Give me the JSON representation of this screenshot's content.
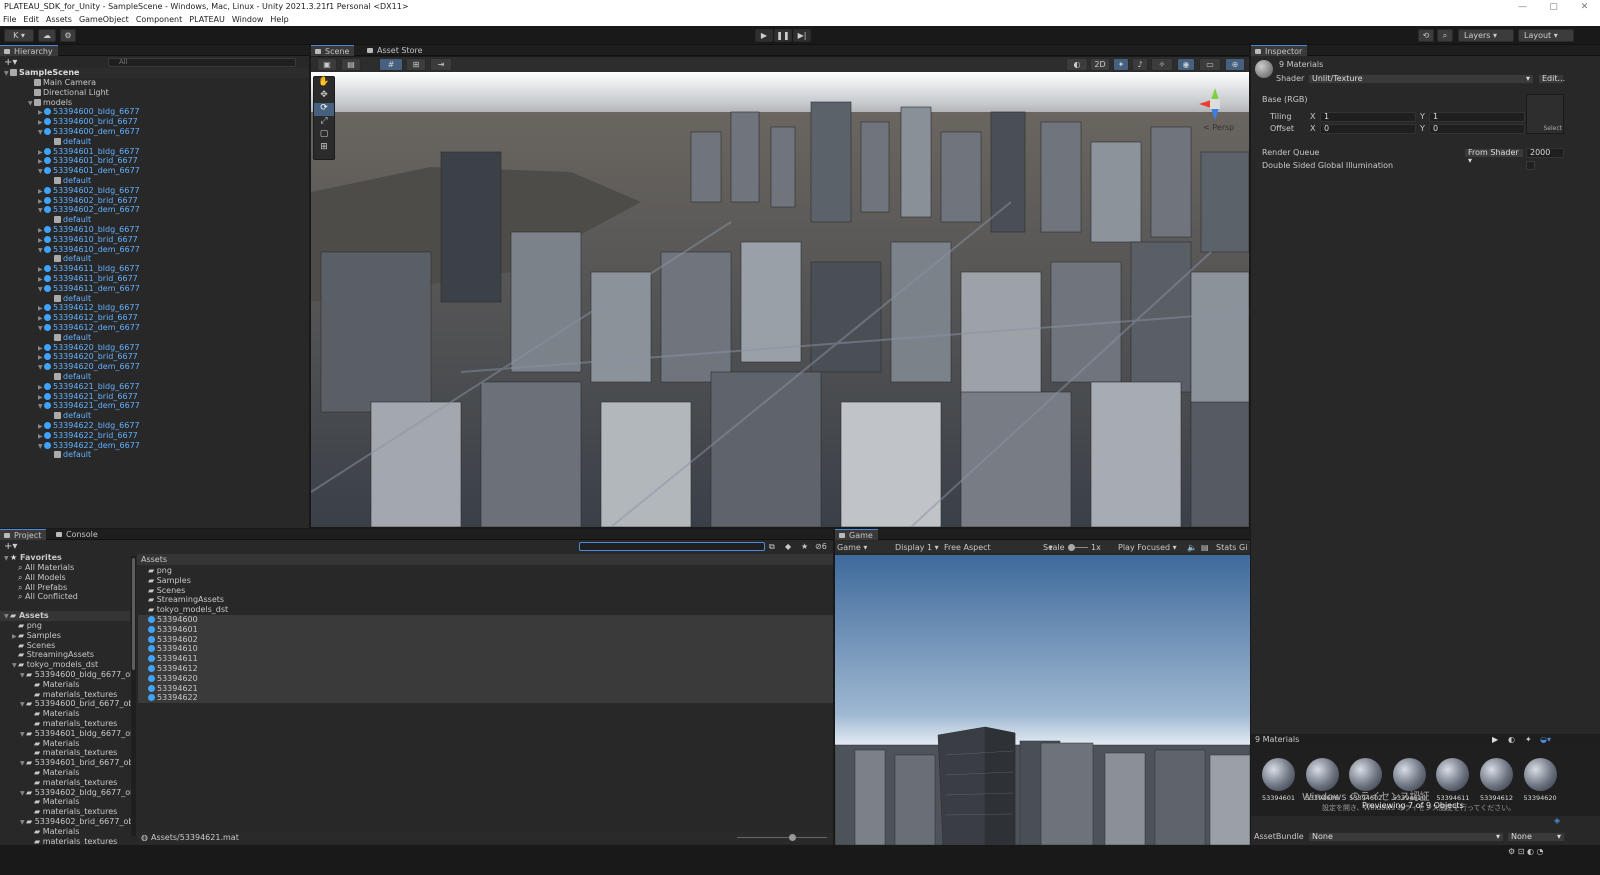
{
  "window": {
    "title": "PLATEAU_SDK_for_Unity - SampleScene - Windows, Mac, Linux - Unity 2021.3.21f1 Personal <DX11>",
    "min": "—",
    "max": "▢",
    "close": "✕"
  },
  "menu": [
    "File",
    "Edit",
    "Assets",
    "GameObject",
    "Component",
    "PLATEAU",
    "Window",
    "Help"
  ],
  "toolbar": {
    "account": "K ▾",
    "layers": "Layers",
    "layout": "Layout"
  },
  "hierarchy": {
    "tab": "Hierarchy",
    "search_placeholder": "All",
    "scene": "SampleScene",
    "items": [
      {
        "label": "Main Camera",
        "depth": 1,
        "type": "go"
      },
      {
        "label": "Directional Light",
        "depth": 1,
        "type": "go"
      },
      {
        "label": "models",
        "depth": 1,
        "type": "go",
        "arrow": "▼"
      },
      {
        "label": "53394600_bldg_6677",
        "depth": 2,
        "type": "prefab",
        "arrow": "▶"
      },
      {
        "label": "53394600_brid_6677",
        "depth": 2,
        "type": "prefab",
        "arrow": "▶"
      },
      {
        "label": "53394600_dem_6677",
        "depth": 2,
        "type": "prefab",
        "arrow": "▼"
      },
      {
        "label": "default",
        "depth": 3,
        "type": "go"
      },
      {
        "label": "53394601_bldg_6677",
        "depth": 2,
        "type": "prefab",
        "arrow": "▶"
      },
      {
        "label": "53394601_brid_6677",
        "depth": 2,
        "type": "prefab",
        "arrow": "▶"
      },
      {
        "label": "53394601_dem_6677",
        "depth": 2,
        "type": "prefab",
        "arrow": "▼"
      },
      {
        "label": "default",
        "depth": 3,
        "type": "go"
      },
      {
        "label": "53394602_bldg_6677",
        "depth": 2,
        "type": "prefab",
        "arrow": "▶"
      },
      {
        "label": "53394602_brid_6677",
        "depth": 2,
        "type": "prefab",
        "arrow": "▶"
      },
      {
        "label": "53394602_dem_6677",
        "depth": 2,
        "type": "prefab",
        "arrow": "▼"
      },
      {
        "label": "default",
        "depth": 3,
        "type": "go"
      },
      {
        "label": "53394610_bldg_6677",
        "depth": 2,
        "type": "prefab",
        "arrow": "▶"
      },
      {
        "label": "53394610_brid_6677",
        "depth": 2,
        "type": "prefab",
        "arrow": "▶"
      },
      {
        "label": "53394610_dem_6677",
        "depth": 2,
        "type": "prefab",
        "arrow": "▼"
      },
      {
        "label": "default",
        "depth": 3,
        "type": "go"
      },
      {
        "label": "53394611_bldg_6677",
        "depth": 2,
        "type": "prefab",
        "arrow": "▶"
      },
      {
        "label": "53394611_brid_6677",
        "depth": 2,
        "type": "prefab",
        "arrow": "▶"
      },
      {
        "label": "53394611_dem_6677",
        "depth": 2,
        "type": "prefab",
        "arrow": "▼"
      },
      {
        "label": "default",
        "depth": 3,
        "type": "go"
      },
      {
        "label": "53394612_bldg_6677",
        "depth": 2,
        "type": "prefab",
        "arrow": "▶"
      },
      {
        "label": "53394612_brid_6677",
        "depth": 2,
        "type": "prefab",
        "arrow": "▶"
      },
      {
        "label": "53394612_dem_6677",
        "depth": 2,
        "type": "prefab",
        "arrow": "▼"
      },
      {
        "label": "default",
        "depth": 3,
        "type": "go"
      },
      {
        "label": "53394620_bldg_6677",
        "depth": 2,
        "type": "prefab",
        "arrow": "▶"
      },
      {
        "label": "53394620_brid_6677",
        "depth": 2,
        "type": "prefab",
        "arrow": "▶"
      },
      {
        "label": "53394620_dem_6677",
        "depth": 2,
        "type": "prefab",
        "arrow": "▼"
      },
      {
        "label": "default",
        "depth": 3,
        "type": "go"
      },
      {
        "label": "53394621_bldg_6677",
        "depth": 2,
        "type": "prefab",
        "arrow": "▶"
      },
      {
        "label": "53394621_brid_6677",
        "depth": 2,
        "type": "prefab",
        "arrow": "▶"
      },
      {
        "label": "53394621_dem_6677",
        "depth": 2,
        "type": "prefab",
        "arrow": "▼"
      },
      {
        "label": "default",
        "depth": 3,
        "type": "go"
      },
      {
        "label": "53394622_bldg_6677",
        "depth": 2,
        "type": "prefab",
        "arrow": "▶"
      },
      {
        "label": "53394622_brid_6677",
        "depth": 2,
        "type": "prefab",
        "arrow": "▶"
      },
      {
        "label": "53394622_dem_6677",
        "depth": 2,
        "type": "prefab",
        "arrow": "▼"
      },
      {
        "label": "default",
        "depth": 3,
        "type": "go"
      }
    ]
  },
  "scene": {
    "tab_scene": "Scene",
    "tab_store": "Asset Store",
    "btn_2d": "2D",
    "persp": "< Persp",
    "axis_y": "y",
    "axis_z": "z"
  },
  "inspector": {
    "tab": "Inspector",
    "title": "9 Materials",
    "shader_label": "Shader",
    "shader_value": "Unlit/Texture",
    "edit": "Edit...",
    "base": "Base (RGB)",
    "tiling": "Tiling",
    "offset": "Offset",
    "x": "X",
    "y": "Y",
    "tiling_x": "1",
    "tiling_y": "1",
    "offset_x": "0",
    "offset_y": "0",
    "select": "Select",
    "render_queue": "Render Queue",
    "rq_mode": "From Shader",
    "rq_value": "2000",
    "dsgi": "Double Sided Global Illumination",
    "preview_title": "9 Materials",
    "preview_text": "Previewing 7 of 9 Objects",
    "watermark": "Windows のライセンス認証",
    "watermark2": "設定を開き、Windows のライセンス認証を行ってください。",
    "asset_bundle": "AssetBundle",
    "ab_value": "None",
    "ab_variant": "None",
    "thumbs": [
      "53394601",
      "53394606",
      "53394602",
      "53394610",
      "53394611",
      "53394612",
      "53394620"
    ]
  },
  "project": {
    "tab_project": "Project",
    "tab_console": "Console",
    "hidden_count": "6",
    "favorites_title": "Favorites",
    "favorites": [
      "All Materials",
      "All Models",
      "All Prefabs",
      "All Conflicted"
    ],
    "assets_title": "Assets",
    "tree": [
      {
        "label": "png",
        "depth": 1
      },
      {
        "label": "Samples",
        "depth": 1,
        "arrow": "▶"
      },
      {
        "label": "Scenes",
        "depth": 1
      },
      {
        "label": "StreamingAssets",
        "depth": 1
      },
      {
        "label": "tokyo_models_dst",
        "depth": 1,
        "arrow": "▼"
      },
      {
        "label": "53394600_bldg_6677_obj",
        "depth": 2,
        "arrow": "▼"
      },
      {
        "label": "Materials",
        "depth": 3
      },
      {
        "label": "materials_textures",
        "depth": 3
      },
      {
        "label": "53394600_brid_6677_obj",
        "depth": 2,
        "arrow": "▼"
      },
      {
        "label": "Materials",
        "depth": 3
      },
      {
        "label": "materials_textures",
        "depth": 3
      },
      {
        "label": "53394601_bldg_6677_obj",
        "depth": 2,
        "arrow": "▼"
      },
      {
        "label": "Materials",
        "depth": 3
      },
      {
        "label": "materials_textures",
        "depth": 3
      },
      {
        "label": "53394601_brid_6677_obj",
        "depth": 2,
        "arrow": "▼"
      },
      {
        "label": "Materials",
        "depth": 3
      },
      {
        "label": "materials_textures",
        "depth": 3
      },
      {
        "label": "53394602_bldg_6677_obj",
        "depth": 2,
        "arrow": "▼"
      },
      {
        "label": "Materials",
        "depth": 3
      },
      {
        "label": "materials_textures",
        "depth": 3
      },
      {
        "label": "53394602_brid_6677_obj",
        "depth": 2,
        "arrow": "▼"
      },
      {
        "label": "Materials",
        "depth": 3
      },
      {
        "label": "materials_textures",
        "depth": 3
      }
    ],
    "content_header": "Assets",
    "folders": [
      "png",
      "Samples",
      "Scenes",
      "StreamingAssets",
      "tokyo_models_dst"
    ],
    "materials": [
      "53394600",
      "53394601",
      "53394602",
      "53394610",
      "53394611",
      "53394612",
      "53394620",
      "53394621",
      "53394622"
    ],
    "path": "Assets/53394621.mat"
  },
  "game": {
    "tab": "Game",
    "mode": "Game",
    "display": "Display 1",
    "aspect": "Free Aspect",
    "scale_label": "Scale",
    "scale_value": "1x",
    "play_focus": "Play Focused",
    "stats": "Stats",
    "gizmos": "Gi"
  }
}
